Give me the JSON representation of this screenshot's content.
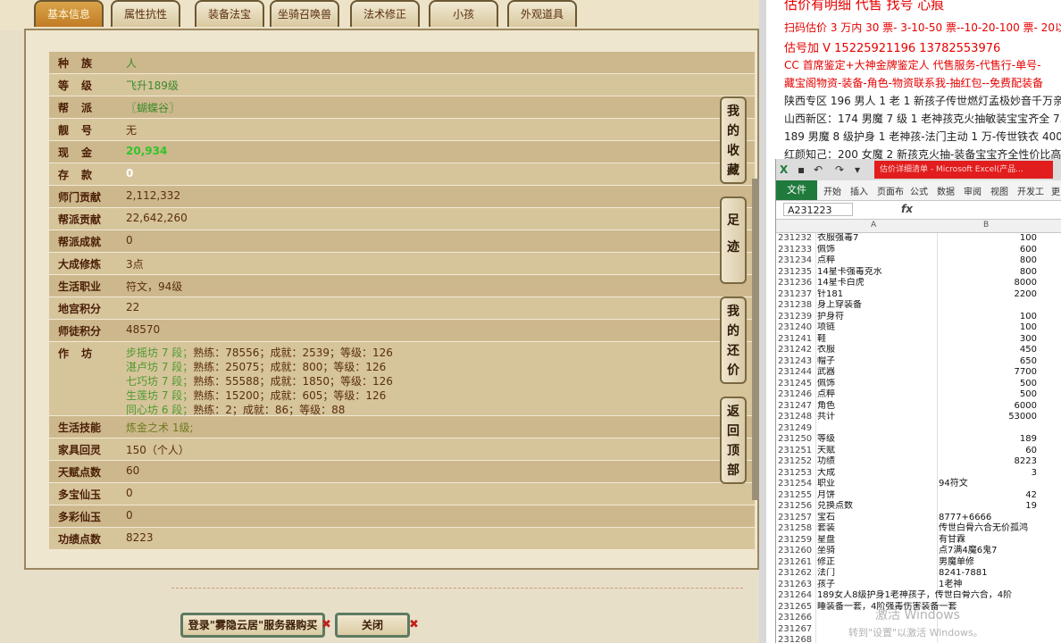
{
  "tabs": [
    {
      "label": "基本信息",
      "active": true
    },
    {
      "label": "属性抗性",
      "active": false
    },
    {
      "label": "装备法宝",
      "active": false
    },
    {
      "label": "坐骑召唤兽",
      "active": false
    },
    {
      "label": "法术修正",
      "active": false
    },
    {
      "label": "小孩",
      "active": false
    },
    {
      "label": "外观道具",
      "active": false
    }
  ],
  "info": {
    "race": {
      "label": "种族",
      "value": "人"
    },
    "level": {
      "label": "等级",
      "value": "飞升189级"
    },
    "guild": {
      "label": "帮派",
      "value": "〖蝴蝶谷〗"
    },
    "pretty_id": {
      "label": "靓号",
      "value": "无"
    },
    "cash": {
      "label": "现金",
      "value": "20,934"
    },
    "deposit": {
      "label": "存款",
      "value": "0"
    },
    "school_contrib": {
      "label": "师门贡献",
      "value": "2,112,332"
    },
    "guild_contrib": {
      "label": "帮派贡献",
      "value": "22,642,260"
    },
    "guild_achieve": {
      "label": "帮派成就",
      "value": "0"
    },
    "dacheng": {
      "label": "大成修炼",
      "value": "3点"
    },
    "life_job": {
      "label": "生活职业",
      "value": "符文，94级"
    },
    "palace_points": {
      "label": "地宫积分",
      "value": "22"
    },
    "mentor_points": {
      "label": "师徒积分",
      "value": "48570"
    },
    "workshop": {
      "label": "作坊",
      "lines": [
        {
          "name": "步摇坊 7 段；",
          "detail": "熟练：78556；成就：2539；等级：126"
        },
        {
          "name": "湛卢坊 7 段；",
          "detail": "熟练：25075；成就：800；等级：126"
        },
        {
          "name": "七巧坊 7 段；",
          "detail": "熟练：55588；成就：1850；等级：126"
        },
        {
          "name": "生莲坊 7 段；",
          "detail": "熟练：15200；成就：605；等级：126"
        },
        {
          "name": "同心坊 6 段；",
          "detail": "熟练：2；成就：86；等级：88"
        }
      ]
    },
    "life_skill": {
      "label": "生活技能",
      "value": "炼金之术 1级;"
    },
    "home_spirit": {
      "label": "家具回灵",
      "value": "150（个人）"
    },
    "talent_points": {
      "label": "天赋点数",
      "value": "60"
    },
    "duobao": {
      "label": "多宝仙玉",
      "value": "0"
    },
    "duocai": {
      "label": "多彩仙玉",
      "value": "0"
    },
    "merit": {
      "label": "功绩点数",
      "value": "8223"
    }
  },
  "side_buttons": [
    {
      "label": "我的收藏"
    },
    {
      "label": "足迹"
    },
    {
      "label": "我的还价"
    },
    {
      "label": "返回顶部"
    }
  ],
  "bottom_buttons": {
    "login": "登录\"雾隐云居\"服务器购买",
    "close": "关闭"
  },
  "promo": [
    "估价有明细 代售 找号 心痕",
    "扫码估价 3 万内 30 票- 3-10-50 票--10-20-100 票- 20以上 150+",
    "估号加 V 15225921196 13782553976",
    "CC 首席鉴定+大神金牌鉴定人 代售服务-代售行-单号-",
    "藏宝阁物资-装备-角色-物资联系我-抽红包--免费配装备",
    "陕西专区 196 男人 1 老 1 新孩子传世燃灯孟极妙音千万亲密 4",
    "山西新区：174 男魔 7 级 1 老神孩克火抽敏装宝宝齐全 7500",
    "189 男魔 8 级护身 1 老神孩-法门主动 1 万-传世铁衣 40000",
    "红颜知己：200 女魔 2 新孩克火抽-装备宝宝齐全性价比高 215"
  ],
  "excel": {
    "title": "估价详细清单 - Microsoft Excel(产品...",
    "ribbon_tabs": [
      "文件",
      "开始",
      "插入",
      "页面布",
      "公式",
      "数据",
      "审阅",
      "视图",
      "开发工",
      "更"
    ],
    "name_box": "A231223",
    "fx": "fx",
    "col_a": "A",
    "col_b": "B",
    "rows": [
      {
        "n": "231232",
        "a": "衣服强毒7",
        "b": "100"
      },
      {
        "n": "231233",
        "a": "佩饰",
        "b": "600"
      },
      {
        "n": "231234",
        "a": "点粹",
        "b": "800"
      },
      {
        "n": "231235",
        "a": "14星卡强毒克水",
        "b": "800"
      },
      {
        "n": "231236",
        "a": "14星卡白虎",
        "b": "8000"
      },
      {
        "n": "231237",
        "a": "针181",
        "b": "2200"
      },
      {
        "n": "231238",
        "a": "身上穿装备",
        "b": ""
      },
      {
        "n": "231239",
        "a": "护身符",
        "b": "100"
      },
      {
        "n": "231240",
        "a": "项链",
        "b": "100"
      },
      {
        "n": "231241",
        "a": "鞋",
        "b": "300"
      },
      {
        "n": "231242",
        "a": "衣服",
        "b": "450"
      },
      {
        "n": "231243",
        "a": "帽子",
        "b": "650"
      },
      {
        "n": "231244",
        "a": "武器",
        "b": "7700"
      },
      {
        "n": "231245",
        "a": "佩饰",
        "b": "500"
      },
      {
        "n": "231246",
        "a": "点粹",
        "b": "500"
      },
      {
        "n": "231247",
        "a": "角色",
        "b": "6000"
      },
      {
        "n": "231248",
        "a": "共计",
        "b": "53000"
      },
      {
        "n": "231249",
        "a": "",
        "b": ""
      },
      {
        "n": "231250",
        "a": "等级",
        "b": "189"
      },
      {
        "n": "231251",
        "a": "天赋",
        "b": "60"
      },
      {
        "n": "231252",
        "a": "功绩",
        "b": "8223"
      },
      {
        "n": "231253",
        "a": "大成",
        "b": "3"
      },
      {
        "n": "231254",
        "a": "职业",
        "b": "94符文",
        "left": true
      },
      {
        "n": "231255",
        "a": "月饼",
        "b": "42"
      },
      {
        "n": "231256",
        "a": "兑换点数",
        "b": "19"
      },
      {
        "n": "231257",
        "a": "宝石",
        "b": "8777+6666",
        "left": true
      },
      {
        "n": "231258",
        "a": "套装",
        "b": "传世白骨六合无价孤鸿",
        "left": true
      },
      {
        "n": "231259",
        "a": "星盘",
        "b": "有甘霖",
        "left": true
      },
      {
        "n": "231260",
        "a": "坐骑",
        "b": "点7满4魔6鬼7",
        "left": true
      },
      {
        "n": "231261",
        "a": "修正",
        "b": "男魔单修",
        "left": true
      },
      {
        "n": "231262",
        "a": "法门",
        "b": "8241-7881",
        "left": true
      },
      {
        "n": "231263",
        "a": "孩子",
        "b": "1老神",
        "left": true
      },
      {
        "n": "231264",
        "wide": "189女人8级护身1老神孩子，传世白骨六合，4阶"
      },
      {
        "n": "231265",
        "wide": "睡装备一套，4阶强毒伤害装备一套"
      },
      {
        "n": "231266",
        "a": "",
        "b": ""
      },
      {
        "n": "231267",
        "a": "",
        "b": ""
      },
      {
        "n": "231268",
        "a": "",
        "b": ""
      }
    ],
    "watermark": "激活 Windows",
    "watermark_sub": "转到\"设置\"以激活 Windows。"
  }
}
